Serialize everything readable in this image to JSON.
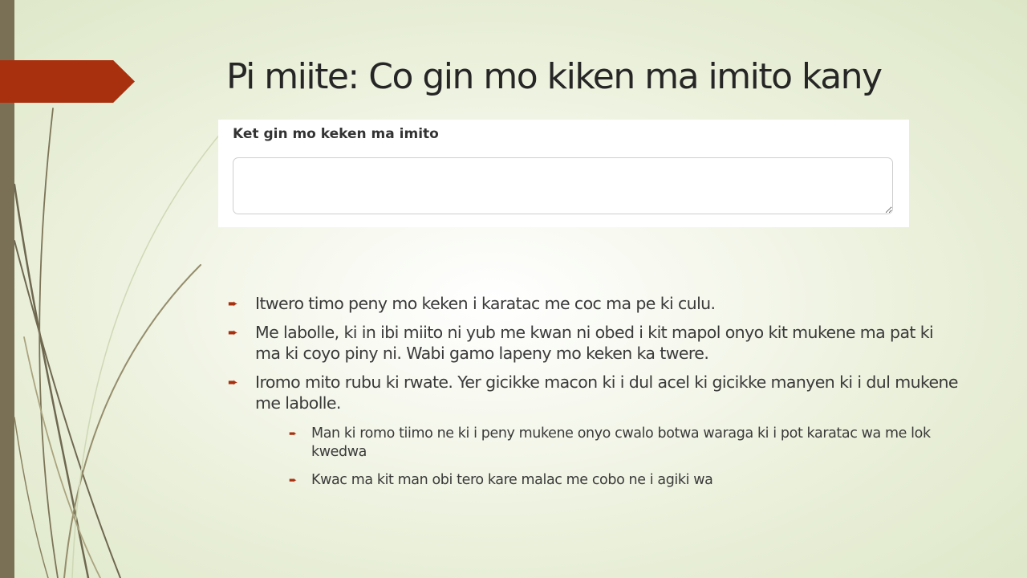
{
  "slide": {
    "title": "Pi miite: Co gin mo kiken ma imito kany",
    "accent_color": "#a8300f",
    "bar_color": "#7a7055"
  },
  "form": {
    "label": "Ket gin mo keken ma imito",
    "textarea_value": ""
  },
  "bullets": [
    {
      "icon": "arrow-bullet-icon",
      "text": "Itwero timo peny mo keken i karatac me coc ma pe ki culu."
    },
    {
      "icon": "arrow-bullet-icon",
      "text": "Me labolle, ki in ibi miito ni yub me kwan ni obed i kit mapol onyo kit mukene ma pat ki ma ki coyo piny ni. Wabi gamo lapeny mo keken ka twere."
    },
    {
      "icon": "arrow-bullet-icon",
      "text": "Iromo mito rubu ki rwate. Yer gicikke macon ki i dul acel ki gicikke manyen ki i dul mukene me labolle."
    }
  ],
  "sub_bullets": [
    {
      "icon": "arrow-bullet-icon",
      "text": "Man ki romo tiimo ne ki i peny mukene onyo cwalo botwa waraga ki i pot karatac wa me lok kwedwa"
    },
    {
      "icon": "arrow-bullet-icon",
      "text": "Kwac ma kit man obi tero kare malac me cobo ne i agiki wa"
    }
  ]
}
